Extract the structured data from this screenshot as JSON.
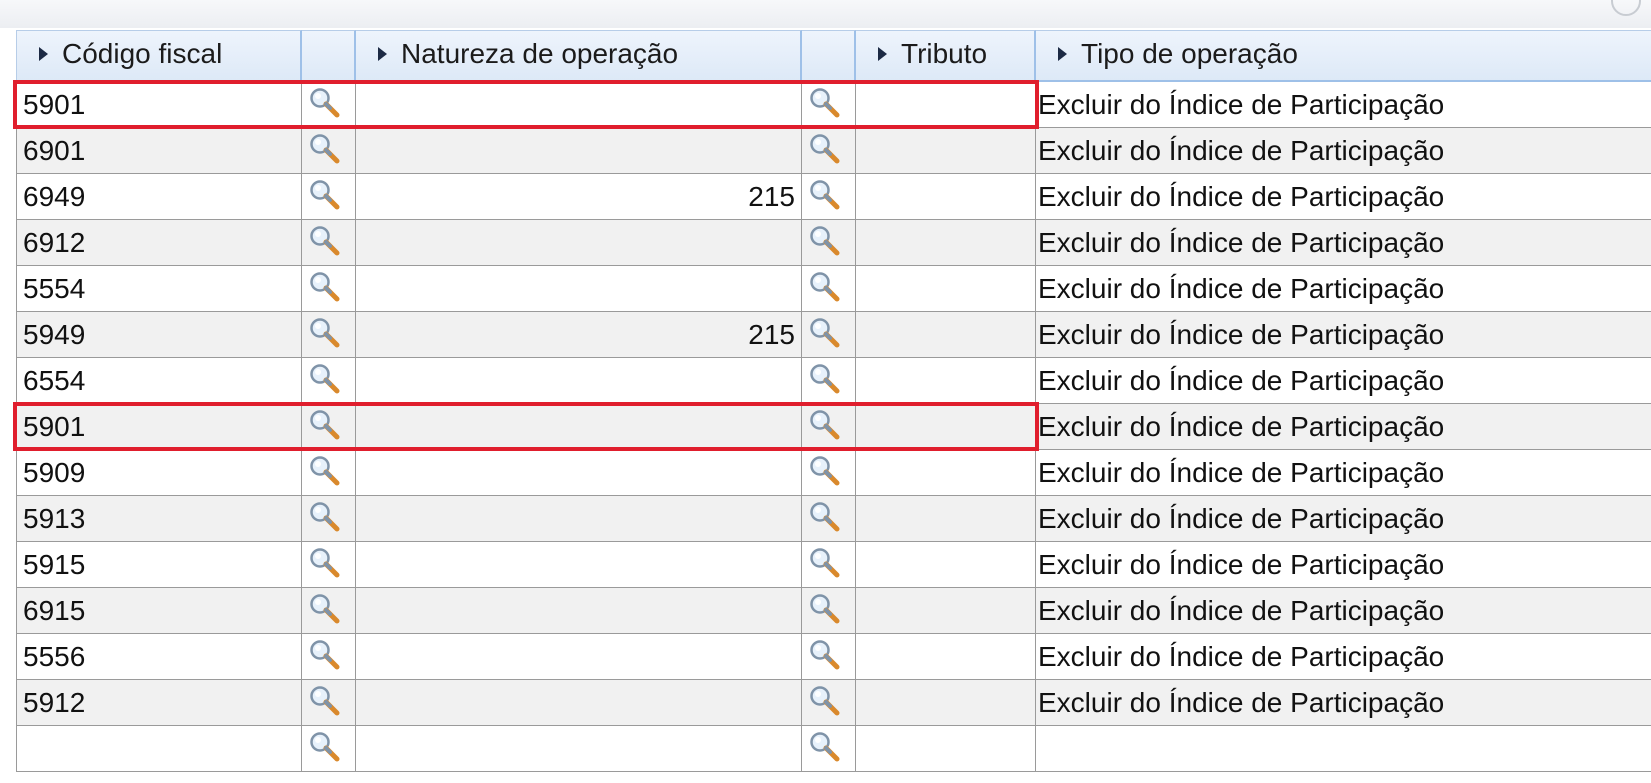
{
  "grid": {
    "columns": {
      "codigo_fiscal": "Código fiscal",
      "natureza_operacao": "Natureza de operação",
      "tributo": "Tributo",
      "tipo_operacao": "Tipo de operação"
    },
    "icons": {
      "lookup": "magnifier-lookup-icon",
      "sort": "sort-arrow-icon"
    },
    "rows": [
      {
        "codigo": "5901",
        "natureza": "",
        "tributo": "",
        "tipo": "Excluir do Índice de Participação",
        "highlighted": true
      },
      {
        "codigo": "6901",
        "natureza": "",
        "tributo": "",
        "tipo": "Excluir do Índice de Participação"
      },
      {
        "codigo": "6949",
        "natureza": "215",
        "tributo": "",
        "tipo": "Excluir do Índice de Participação"
      },
      {
        "codigo": "6912",
        "natureza": "",
        "tributo": "",
        "tipo": "Excluir do Índice de Participação"
      },
      {
        "codigo": "5554",
        "natureza": "",
        "tributo": "",
        "tipo": "Excluir do Índice de Participação"
      },
      {
        "codigo": "5949",
        "natureza": "215",
        "tributo": "",
        "tipo": "Excluir do Índice de Participação"
      },
      {
        "codigo": "6554",
        "natureza": "",
        "tributo": "",
        "tipo": "Excluir do Índice de Participação"
      },
      {
        "codigo": "5901",
        "natureza": "",
        "tributo": "",
        "tipo": "Excluir do Índice de Participação",
        "highlighted": true
      },
      {
        "codigo": "5909",
        "natureza": "",
        "tributo": "",
        "tipo": "Excluir do Índice de Participação"
      },
      {
        "codigo": "5913",
        "natureza": "",
        "tributo": "",
        "tipo": "Excluir do Índice de Participação"
      },
      {
        "codigo": "5915",
        "natureza": "",
        "tributo": "",
        "tipo": "Excluir do Índice de Participação"
      },
      {
        "codigo": "6915",
        "natureza": "",
        "tributo": "",
        "tipo": "Excluir do Índice de Participação"
      },
      {
        "codigo": "5556",
        "natureza": "",
        "tributo": "",
        "tipo": "Excluir do Índice de Participação"
      },
      {
        "codigo": "5912",
        "natureza": "",
        "tributo": "",
        "tipo": "Excluir do Índice de Participação"
      },
      {
        "codigo": "",
        "natureza": "",
        "tributo": "",
        "tipo": ""
      }
    ]
  },
  "colors": {
    "header_bg": "#dde9f7",
    "header_border": "#9ec0e8",
    "row_alt_bg": "#f1f1f1",
    "highlight_border": "#e01e2d"
  }
}
